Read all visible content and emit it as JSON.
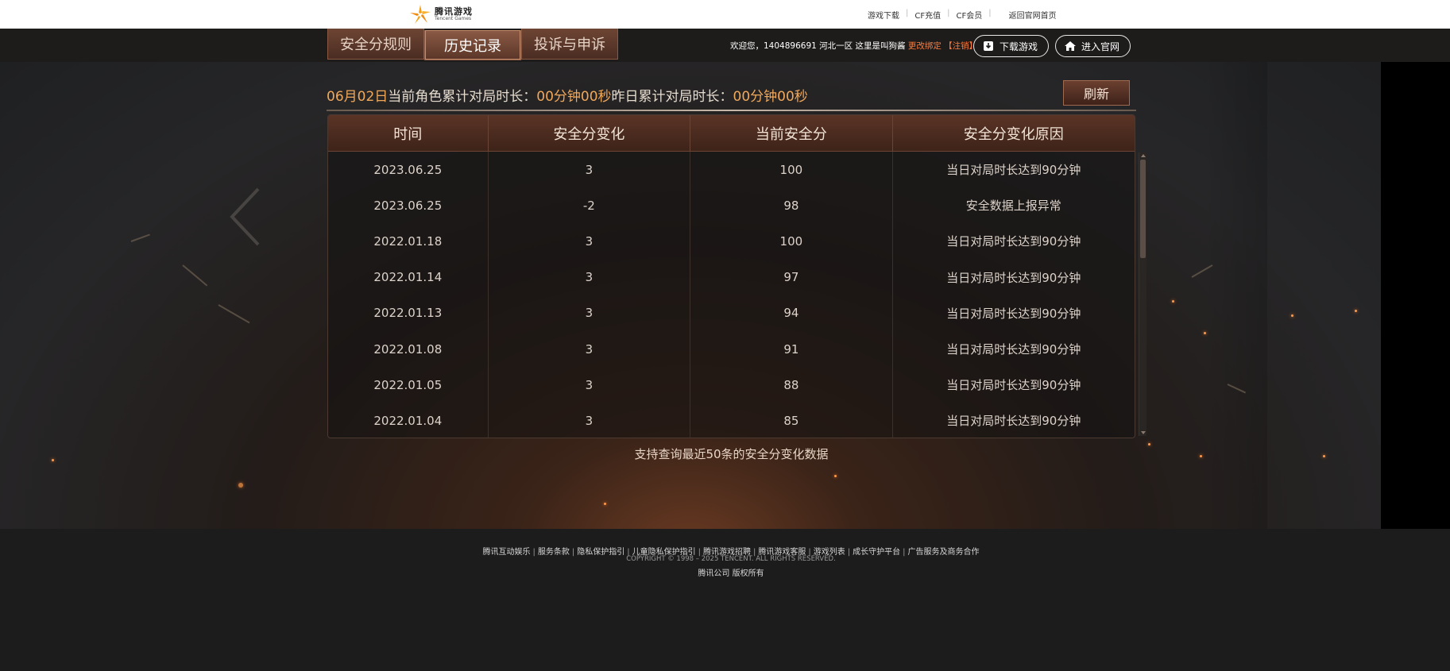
{
  "top": {
    "logo_cn": "腾讯游戏",
    "logo_en": "Tencent Games",
    "nav": [
      "游戏下载",
      "CF充值",
      "CF会员",
      "返回官网首页"
    ]
  },
  "header": {
    "tabs": [
      "安全分规则",
      "历史记录",
      "投诉与申诉"
    ],
    "active_tab": "历史记录",
    "welcome_prefix": "欢迎您，1404896691 河北一区 这里是叫狗酱",
    "change_bind": "更改绑定",
    "logout": "【注销】",
    "download_btn": "下载游戏",
    "site_btn": "进入官网"
  },
  "summary": {
    "date": "06月02日",
    "today_label": "当前角色累计对局时长：",
    "today_value": "00分钟00秒",
    "yesterday_label": "昨日累计对局时长：",
    "yesterday_value": "00分钟00秒",
    "refresh": "刷新"
  },
  "table": {
    "headers": [
      "时间",
      "安全分变化",
      "当前安全分",
      "安全分变化原因"
    ],
    "rows": [
      [
        "2023.06.25",
        "3",
        "100",
        "当日对局时长达到90分钟"
      ],
      [
        "2023.06.25",
        "-2",
        "98",
        "安全数据上报异常"
      ],
      [
        "2022.01.18",
        "3",
        "100",
        "当日对局时长达到90分钟"
      ],
      [
        "2022.01.14",
        "3",
        "97",
        "当日对局时长达到90分钟"
      ],
      [
        "2022.01.13",
        "3",
        "94",
        "当日对局时长达到90分钟"
      ],
      [
        "2022.01.08",
        "3",
        "91",
        "当日对局时长达到90分钟"
      ],
      [
        "2022.01.05",
        "3",
        "88",
        "当日对局时长达到90分钟"
      ],
      [
        "2022.01.04",
        "3",
        "85",
        "当日对局时长达到90分钟"
      ]
    ]
  },
  "note": "支持查询最近50条的安全分变化数据",
  "footer": {
    "links": [
      "腾讯互动娱乐",
      "服务条款",
      "隐私保护指引",
      "儿童隐私保护指引",
      "腾讯游戏招聘",
      "腾讯游戏客服",
      "游戏列表",
      "成长守护平台",
      "广告服务及商务合作"
    ],
    "copyright": "COPYRIGHT © 1998 – 2025 TENCENT. ALL RIGHTS RESERVED.",
    "company": "腾讯公司 版权所有"
  },
  "colors": {
    "accent_orange": "#f0a85a",
    "link_orange": "#ff7a3a",
    "tab_brown": "#5a3628"
  }
}
